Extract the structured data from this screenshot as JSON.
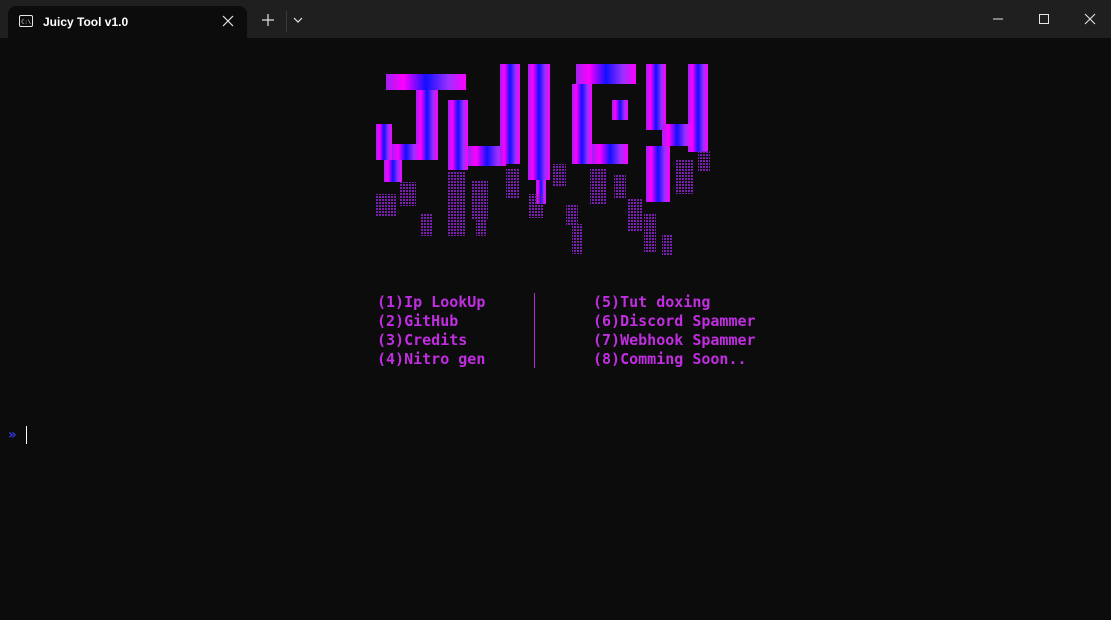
{
  "window": {
    "tab_title": "Juicy Tool v1.0",
    "tab_icon": "terminal-icon",
    "new_tab_icon": "plus-icon",
    "dropdown_icon": "chevron-down-icon",
    "close_tab_icon": "close-icon",
    "controls": [
      "minimize-icon",
      "maximize-icon",
      "close-icon"
    ]
  },
  "menu": {
    "left": [
      "(1)Ip LookUp",
      "(2)GitHub",
      "(3)Credits",
      "(4)Nitro gen"
    ],
    "right": [
      "(5)Tut doxing",
      "(6)Discord Spammer",
      "(7)Webhook Spammer",
      "(8)Comming Soon.."
    ]
  },
  "prompt": {
    "symbol": "»"
  },
  "colors": {
    "background": "#0c0c0c",
    "titlebar": "#1f1f1f",
    "menu_text": "#c12ee1",
    "prompt": "#3b3bf5",
    "logo_gradient": [
      "#a020f0",
      "#ff00ff",
      "#1010ff",
      "#9b30ff"
    ]
  }
}
